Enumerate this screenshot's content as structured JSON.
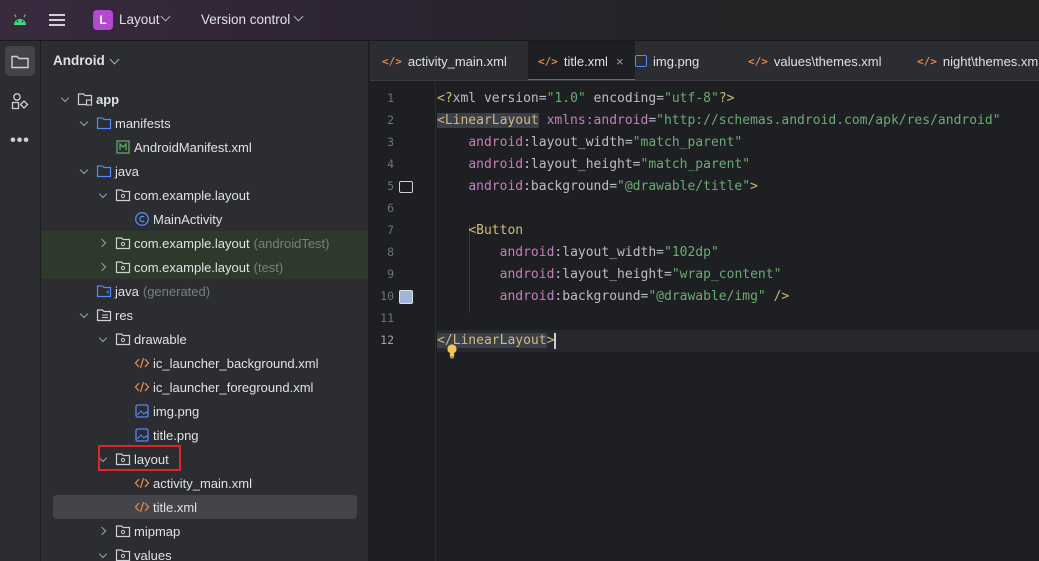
{
  "titlebar": {
    "project_initial": "L",
    "project_name": "Layout",
    "vcs_label": "Version control",
    "colors": {
      "badge": "#b14ad0",
      "android": "#3ddc84"
    }
  },
  "toolstrip": {
    "icons": [
      "folder-icon",
      "structure-icon",
      "more-icon"
    ],
    "more_label": "•••"
  },
  "project_panel": {
    "view_label": "Android",
    "tree": [
      {
        "label": "app",
        "suffix": "",
        "indent": 0,
        "twisty": "open",
        "icon": "module"
      },
      {
        "label": "manifests",
        "suffix": "",
        "indent": 1,
        "twisty": "open",
        "icon": "folder"
      },
      {
        "label": "AndroidManifest.xml",
        "suffix": "",
        "indent": 2,
        "twisty": "none",
        "icon": "manifest"
      },
      {
        "label": "java",
        "suffix": "",
        "indent": 1,
        "twisty": "open",
        "icon": "folder"
      },
      {
        "label": "com.example.layout",
        "suffix": "",
        "indent": 2,
        "twisty": "open",
        "icon": "package"
      },
      {
        "label": "MainActivity",
        "suffix": "",
        "indent": 3,
        "twisty": "none",
        "icon": "class"
      },
      {
        "label": "com.example.layout",
        "suffix": "(androidTest)",
        "indent": 2,
        "twisty": "closed",
        "icon": "package"
      },
      {
        "label": "com.example.layout",
        "suffix": "(test)",
        "indent": 2,
        "twisty": "closed",
        "icon": "package"
      },
      {
        "label": "java",
        "suffix": "(generated)",
        "indent": 1,
        "twisty": "none",
        "icon": "generated"
      },
      {
        "label": "res",
        "suffix": "",
        "indent": 1,
        "twisty": "open",
        "icon": "res"
      },
      {
        "label": "drawable",
        "suffix": "",
        "indent": 2,
        "twisty": "open",
        "icon": "package"
      },
      {
        "label": "ic_launcher_background.xml",
        "suffix": "",
        "indent": 3,
        "twisty": "none",
        "icon": "xml"
      },
      {
        "label": "ic_launcher_foreground.xml",
        "suffix": "",
        "indent": 3,
        "twisty": "none",
        "icon": "xml"
      },
      {
        "label": "img.png",
        "suffix": "",
        "indent": 3,
        "twisty": "none",
        "icon": "image"
      },
      {
        "label": "title.png",
        "suffix": "",
        "indent": 3,
        "twisty": "none",
        "icon": "image"
      },
      {
        "label": "layout",
        "suffix": "",
        "indent": 2,
        "twisty": "open",
        "icon": "package"
      },
      {
        "label": "activity_main.xml",
        "suffix": "",
        "indent": 3,
        "twisty": "none",
        "icon": "xml"
      },
      {
        "label": "title.xml",
        "suffix": "",
        "indent": 3,
        "twisty": "none",
        "icon": "xml"
      },
      {
        "label": "mipmap",
        "suffix": "",
        "indent": 2,
        "twisty": "closed",
        "icon": "package"
      },
      {
        "label": "values",
        "suffix": "",
        "indent": 2,
        "twisty": "open",
        "icon": "package"
      }
    ]
  },
  "editor": {
    "tabs": [
      {
        "label": "activity_main.xml",
        "icon": "xml",
        "active": false
      },
      {
        "label": "title.xml",
        "icon": "xml",
        "active": true,
        "close": "×"
      },
      {
        "label": "img.png",
        "icon": "image",
        "active": false
      },
      {
        "label": "values\\themes.xml",
        "icon": "xml",
        "active": false
      },
      {
        "label": "night\\themes.xml",
        "icon": "xml",
        "active": false
      }
    ],
    "xml_icon_text": "</>",
    "line_numbers": [
      "1",
      "2",
      "3",
      "4",
      "5",
      "6",
      "7",
      "8",
      "9",
      "10",
      "11",
      "12"
    ],
    "current_line": "12",
    "code": [
      [
        [
          "punct",
          "<?"
        ],
        [
          "plain",
          "xml "
        ],
        [
          "plain",
          "version"
        ],
        [
          "plain",
          "="
        ],
        [
          "str",
          "\"1.0\""
        ],
        [
          "plain",
          " encoding"
        ],
        [
          "plain",
          "="
        ],
        [
          "str",
          "\"utf-8\""
        ],
        [
          "punct",
          "?>"
        ]
      ],
      [
        [
          "tagh",
          "<LinearLayout"
        ],
        [
          "plain",
          " "
        ],
        [
          "ns",
          "xmlns:android"
        ],
        [
          "plain",
          "="
        ],
        [
          "str",
          "\"http://schemas.android.com/apk/res/android\""
        ]
      ],
      [
        [
          "plain",
          "    "
        ],
        [
          "ns",
          "android"
        ],
        [
          "plain",
          ":layout_width="
        ],
        [
          "str",
          "\"match_parent\""
        ]
      ],
      [
        [
          "plain",
          "    "
        ],
        [
          "ns",
          "android"
        ],
        [
          "plain",
          ":layout_height="
        ],
        [
          "str",
          "\"match_parent\""
        ]
      ],
      [
        [
          "plain",
          "    "
        ],
        [
          "ns",
          "android"
        ],
        [
          "plain",
          ":background="
        ],
        [
          "str",
          "\"@drawable/title\""
        ],
        [
          "tag",
          ">"
        ]
      ],
      [],
      [
        [
          "plain",
          "    "
        ],
        [
          "tag",
          "<Button"
        ]
      ],
      [
        [
          "plain",
          "        "
        ],
        [
          "ns",
          "android"
        ],
        [
          "plain",
          ":layout_width="
        ],
        [
          "str",
          "\"102dp\""
        ]
      ],
      [
        [
          "plain",
          "        "
        ],
        [
          "ns",
          "android"
        ],
        [
          "plain",
          ":layout_height="
        ],
        [
          "str",
          "\"wrap_content\""
        ]
      ],
      [
        [
          "plain",
          "        "
        ],
        [
          "ns",
          "android"
        ],
        [
          "plain",
          ":background="
        ],
        [
          "str",
          "\"@drawable/img\""
        ],
        [
          "tag",
          " />"
        ]
      ],
      [],
      [
        [
          "tagh",
          "</LinearLayout"
        ],
        [
          "tag",
          ">"
        ]
      ]
    ]
  }
}
